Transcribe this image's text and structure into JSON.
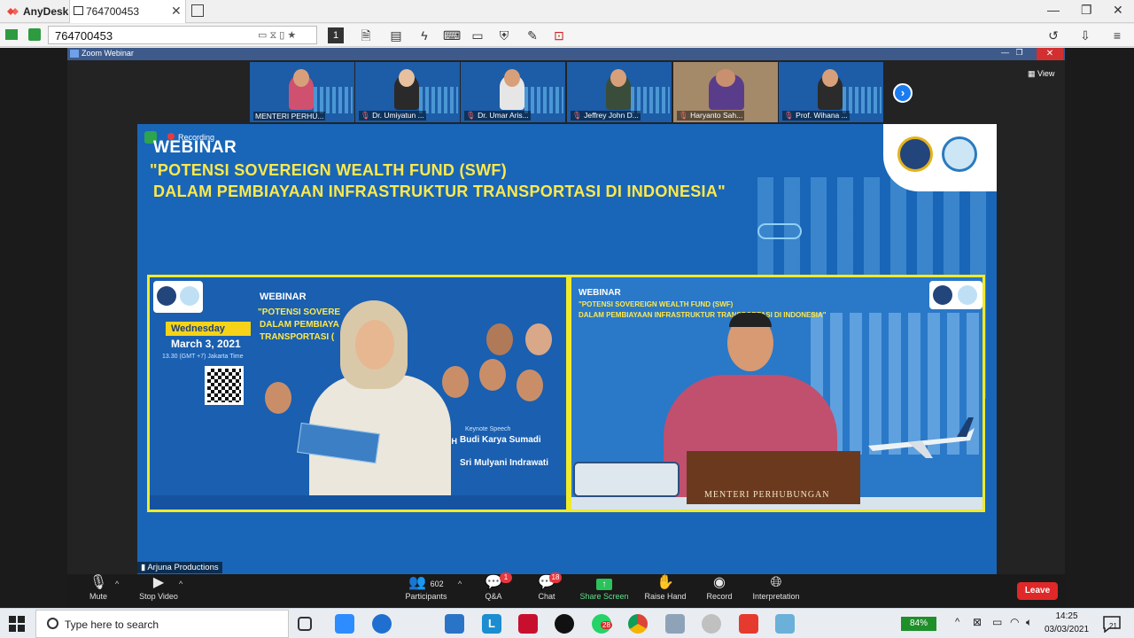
{
  "anydesk": {
    "app_name": "AnyDesk",
    "tab_title": "764700453",
    "tab_close": "✕",
    "address": "764700453",
    "window_controls": [
      "—",
      "❐",
      "✕"
    ],
    "toolbar_icons": [
      "monitor-1-icon",
      "file-transfer-icon",
      "chat-icon",
      "action-icon",
      "keyboard-icon",
      "display-icon",
      "permissions-icon",
      "whiteboard-icon",
      "record-icon"
    ],
    "monitor_number": "1"
  },
  "zoom": {
    "window_title": "Zoom Webinar",
    "view_label": "View",
    "next_page": "›",
    "gallery": [
      {
        "name": "MENTERI PERHU...",
        "muted": false,
        "color": "#d05070"
      },
      {
        "name": "Dr. Umiyatun ...",
        "muted": true,
        "color": "#2a2a2a"
      },
      {
        "name": "Dr. Umar Aris...",
        "muted": true,
        "color": "#e6e6e6"
      },
      {
        "name": "Jeffrey John D...",
        "muted": true,
        "color": "#3a4d3a"
      },
      {
        "name": "Haryanto Sah...",
        "muted": true,
        "color": "#5a3d8a"
      },
      {
        "name": "Prof. Wihana ...",
        "muted": true,
        "color": "#2b2b2b"
      }
    ],
    "recording_label": "Recording",
    "slide": {
      "webinar": "WEBINAR",
      "line1": "\"POTENSI SOVEREIGN WEALTH FUND (SWF)",
      "line2": "DALAM PEMBIAYAAN INFRASTRUKTUR  TRANSPORTASI DI INDONESIA\""
    },
    "panel_left": {
      "webinar": "WEBINAR",
      "l1": "\"POTENSI SOVERE",
      "l2": "DALAM PEMBIAYA",
      "l3": "TRANSPORTASI (",
      "day": "Wednesday",
      "date": "March 3, 2021",
      "time": "13.30 (GMT +7) Jakarta Time",
      "keynote_label": "Keynote Speech",
      "keynote1": "Budi Karya Sumadi",
      "keynote2": "Sri Mulyani Indrawati",
      "mh": "M., MH"
    },
    "panel_right": {
      "webinar": "WEBINAR",
      "l1": "\"POTENSI SOVEREIGN WEALTH FUND (SWF)",
      "l2": "DALAM PEMBIAYAAN INFRASTRUKTUR  TRANSPORTASI DI INDONESIA\"",
      "desk_label": "MENTERI PERHUBUNGAN"
    },
    "production_label": "Arjuna Productions",
    "controls": {
      "mute": "Mute",
      "stop_video": "Stop Video",
      "participants": "Participants",
      "participants_count": "602",
      "qa": "Q&A",
      "qa_badge": "1",
      "chat": "Chat",
      "chat_badge": "18",
      "share": "Share Screen",
      "raise": "Raise Hand",
      "record": "Record",
      "interpretation": "Interpretation",
      "leave": "Leave"
    }
  },
  "taskbar": {
    "search_placeholder": "Type here to search",
    "battery": "84%",
    "time": "14:25",
    "date": "03/03/2021",
    "notifications": "21",
    "whatsapp_badge": "28",
    "apps": [
      {
        "name": "task-view-icon",
        "color": "#e9edf2"
      },
      {
        "name": "zoom-app-icon",
        "color": "#2d8cff"
      },
      {
        "name": "edge-icon",
        "color": "#1f6fd1"
      },
      {
        "name": "mail-icon",
        "color": "#2a74c8"
      },
      {
        "name": "l-app-icon",
        "color": "#1b8dd0"
      },
      {
        "name": "mcafee-icon",
        "color": "#c8102e"
      },
      {
        "name": "xbox-icon",
        "color": "#111111"
      },
      {
        "name": "whatsapp-icon",
        "color": "#25d366"
      },
      {
        "name": "chrome-icon",
        "color": "#e8a21a"
      },
      {
        "name": "tool-app-icon",
        "color": "#8fa3b8"
      },
      {
        "name": "snip-icon",
        "color": "#c0c0c0"
      },
      {
        "name": "anydesk-app-icon",
        "color": "#e63a2e"
      },
      {
        "name": "notes-app-icon",
        "color": "#6ab0d8"
      }
    ]
  }
}
